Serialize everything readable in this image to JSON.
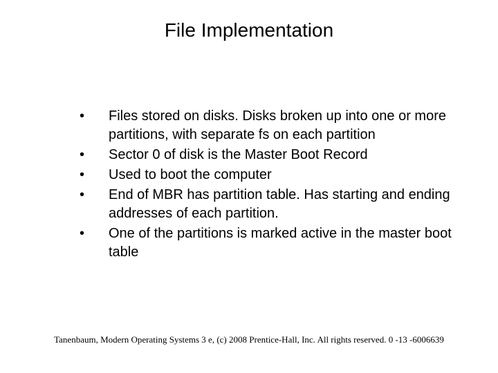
{
  "title": "File Implementation",
  "bullets": [
    "Files stored on disks. Disks broken up into one or more partitions, with separate fs on each partition",
    "Sector 0 of disk is the Master Boot Record",
    "Used to boot the computer",
    "End of MBR has partition table. Has starting and ending addresses of each partition.",
    "One of the partitions is marked active in the master boot table"
  ],
  "footer": "Tanenbaum, Modern Operating Systems 3 e, (c) 2008 Prentice-Hall, Inc. All rights reserved. 0 -13 -6006639"
}
